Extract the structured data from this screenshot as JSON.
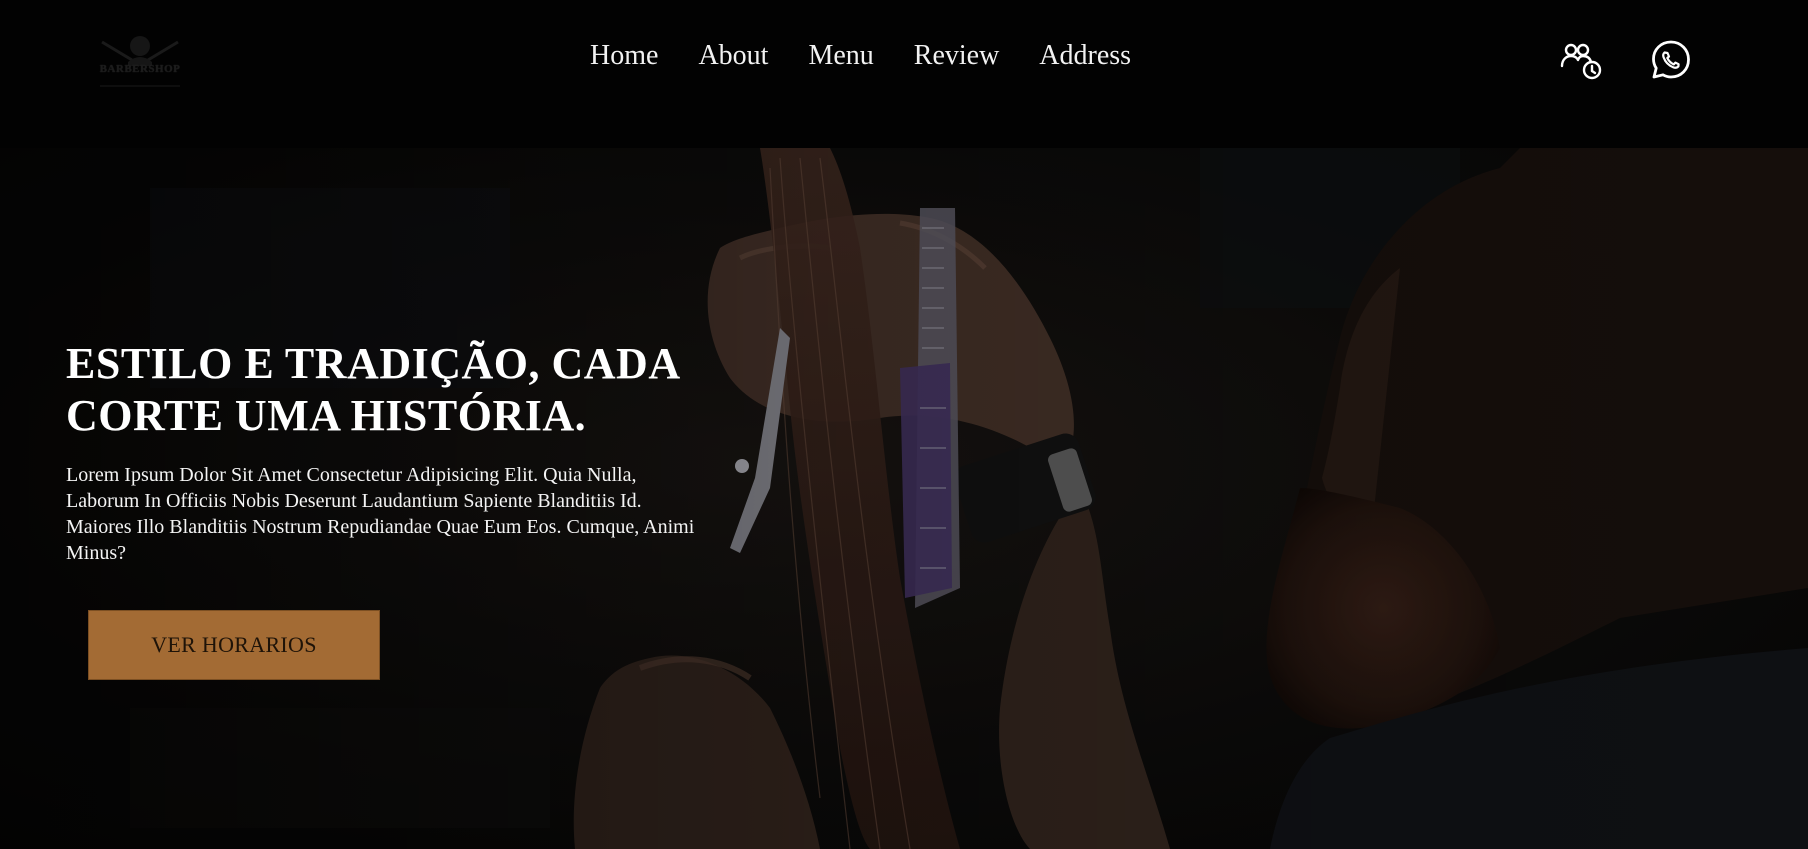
{
  "header": {
    "logo_text": "BARBERSHOP",
    "nav": [
      {
        "label": "Home"
      },
      {
        "label": "About"
      },
      {
        "label": "Menu"
      },
      {
        "label": "Review"
      },
      {
        "label": "Address"
      }
    ],
    "icons": [
      "users-clock-icon",
      "whatsapp-icon"
    ]
  },
  "hero": {
    "title": "ESTILO E TRADIÇÃO, CADA CORTE UMA HISTÓRIA.",
    "text": "Lorem Ipsum Dolor Sit Amet Consectetur Adipisicing Elit. Quia Nulla, Laborum In Officiis Nobis Deserunt Laudantium Sapiente Blanditiis Id. Maiores Illo Blanditiis Nostrum Repudiandae Quae Eum Eos. Cumque, Animi Minus?",
    "button_label": "VER HORARIOS",
    "button_color": "#a36b34"
  }
}
